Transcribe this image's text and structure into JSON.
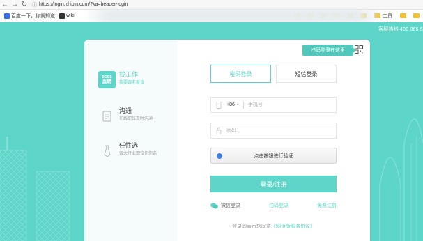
{
  "browser": {
    "url": "https://login.zhipin.com/?ka=header-login",
    "bookmarks": [
      "百度一下，你就知道",
      "wiki -"
    ],
    "folder_label": "工具"
  },
  "page": {
    "hotline": "客服热线 400 065 5",
    "colors": {
      "accent": "#5dd5c8",
      "background": "#5dd5c8",
      "captcha_dot": "#3e7ef1"
    }
  },
  "features": [
    {
      "title": "找工作",
      "subtitle": "我要跟老板谈",
      "icon": "boss-logo-icon",
      "logo_small": "BOSS",
      "logo_big": "直聘"
    },
    {
      "title": "沟通",
      "subtitle": "在线职位及时沟通",
      "icon": "chat-document-icon"
    },
    {
      "title": "任性选",
      "subtitle": "各大行业职位任你选",
      "icon": "tie-icon"
    }
  ],
  "qr": {
    "tip": "扫码登录在这里"
  },
  "tabs": [
    {
      "label": "密码登录",
      "active": true
    },
    {
      "label": "短信登录",
      "active": false
    }
  ],
  "form": {
    "country_code": "+86",
    "phone_placeholder": "手机号",
    "password_placeholder": "密码",
    "captcha_label": "点击按钮进行验证",
    "submit_label": "登录/注册"
  },
  "links": {
    "wechat": "微信登录",
    "scan": "扫码登录",
    "register": "免费注册"
  },
  "agreement": {
    "prefix": "登录即表示您同意",
    "link": "《网页版服务协议》"
  }
}
